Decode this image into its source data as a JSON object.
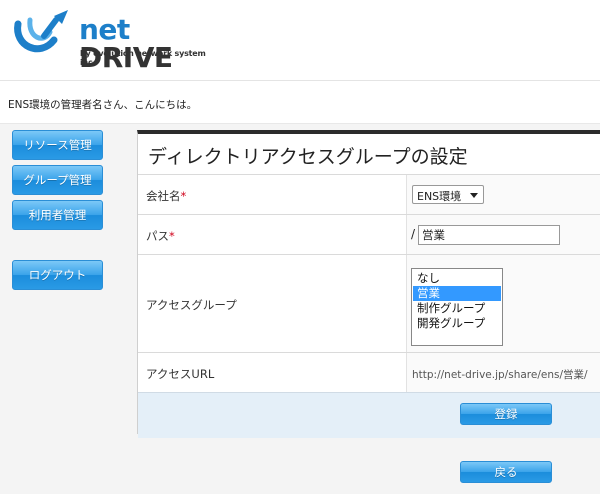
{
  "brand": {
    "name_net": "net",
    "name_drive": "DRIVE",
    "tagline": "by evolution network system inc.",
    "accent_color": "#1d7fc9"
  },
  "welcome": {
    "text": "ENS環境の管理者名さん、こんにちは。"
  },
  "sidebar": {
    "items": [
      {
        "label": "リソース管理"
      },
      {
        "label": "グループ管理"
      },
      {
        "label": "利用者管理"
      }
    ],
    "logout_label": "ログアウト"
  },
  "form": {
    "title": "ディレクトリアクセスグループの設定",
    "company": {
      "label": "会社名",
      "required_mark": "*",
      "selected": "ENS環境"
    },
    "path": {
      "label": "パス",
      "required_mark": "*",
      "prefix": "/",
      "value": "営業"
    },
    "access_group": {
      "label": "アクセスグループ",
      "options": [
        "なし",
        "営業",
        "制作グループ",
        "開発グループ"
      ],
      "selected": "営業"
    },
    "access_url": {
      "label": "アクセスURL",
      "value": "http://net-drive.jp/share/ens/営業/"
    },
    "register_label": "登録"
  },
  "back_label": "戻る"
}
